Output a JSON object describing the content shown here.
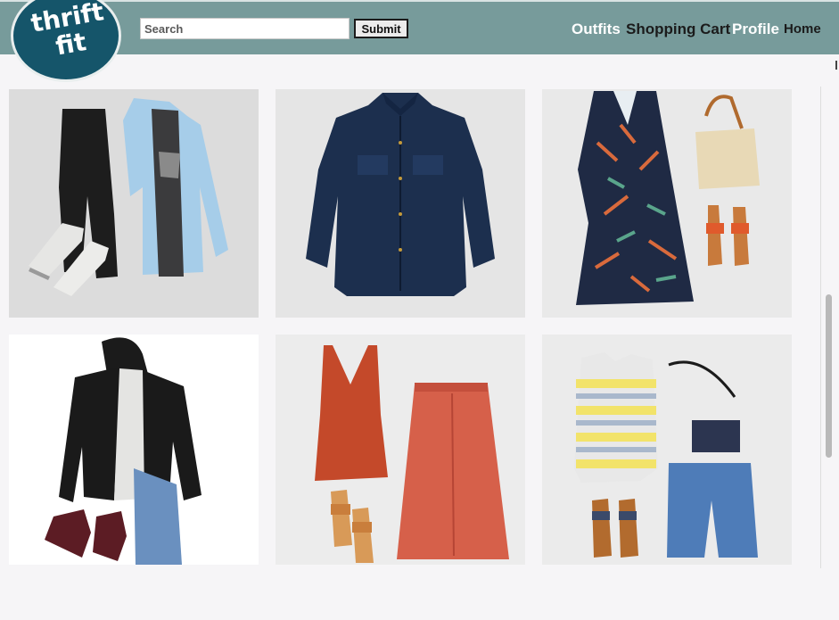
{
  "brand": {
    "logo_line1": "thrift",
    "logo_line2": "fit"
  },
  "search": {
    "placeholder": "Search",
    "submit_label": "Submit"
  },
  "nav": {
    "outfits": "Outfits",
    "cart": "Shopping Cart",
    "profile": "Profile",
    "home": "Home"
  },
  "colors": {
    "header": "#779b9b",
    "logo": "#15556a",
    "page_bg": "#f6f5f7"
  },
  "outfits": [
    {
      "icon": "black-pants-denim-shirt-sneakers-outfit"
    },
    {
      "icon": "navy-denim-button-shirt"
    },
    {
      "icon": "floral-wrap-dress-bag-sandals-outfit"
    },
    {
      "icon": "leather-jacket-jeans-boots-outfit"
    },
    {
      "icon": "rust-tank-skirt-sandals-outfit"
    },
    {
      "icon": "striped-top-denim-shorts-outfit"
    }
  ]
}
